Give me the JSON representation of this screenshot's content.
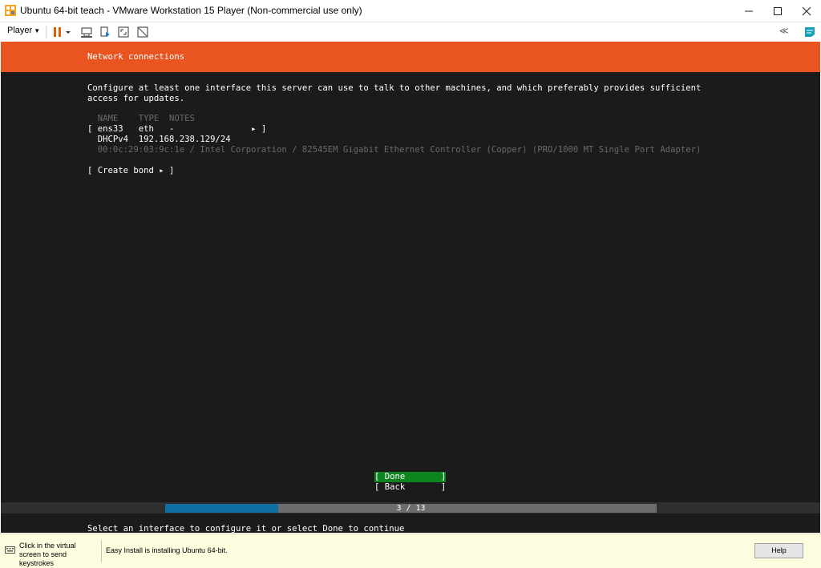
{
  "window": {
    "title": "Ubuntu 64-bit teach - VMware Workstation 15 Player (Non-commercial use only)",
    "minimize_icon": "minimize-icon",
    "maximize_icon": "maximize-icon",
    "close_icon": "close-icon"
  },
  "toolbar": {
    "player_label": "Player",
    "icons": [
      "pause-icon",
      "send-ctrl-alt-del-icon",
      "removable-devices-icon",
      "fit-guest-icon",
      "unity-icon",
      "collapse-icon",
      "library-icon"
    ],
    "collapse_glyph": "≪"
  },
  "installer": {
    "header_title": "Network connections",
    "intro_line1": "Configure at least one interface this server can use to talk to other machines, and which preferably provides sufficient",
    "intro_line2": "access for updates.",
    "columns_header": "  NAME    TYPE  NOTES",
    "interface_row": "[ ens33   eth   -               ▸ ]",
    "dhcp_row": "  DHCPv4  192.168.238.129/24",
    "hw_row": "  00:0c:29:03:9c:1e / Intel Corporation / 82545EM Gigabit Ethernet Controller (Copper) (PRO/1000 MT Single Port Adapter)",
    "create_bond": "[ Create bond ▸ ]",
    "done_button": "[ Done       ]",
    "back_button": "[ Back       ]",
    "progress": {
      "current": 3,
      "total": 13,
      "label": "3 / 13",
      "fraction": 0.23
    },
    "footer_hint": "Select an interface to configure it or select Done to continue",
    "colors": {
      "accent": "#e95420",
      "done_bg": "#0e8420",
      "progress_fill": "#0f6fa3",
      "background": "#1b1b1b"
    }
  },
  "statusbar": {
    "hint": "Click in the virtual screen to send keystrokes",
    "message": "Easy Install is installing Ubuntu 64-bit.",
    "help_label": "Help"
  }
}
